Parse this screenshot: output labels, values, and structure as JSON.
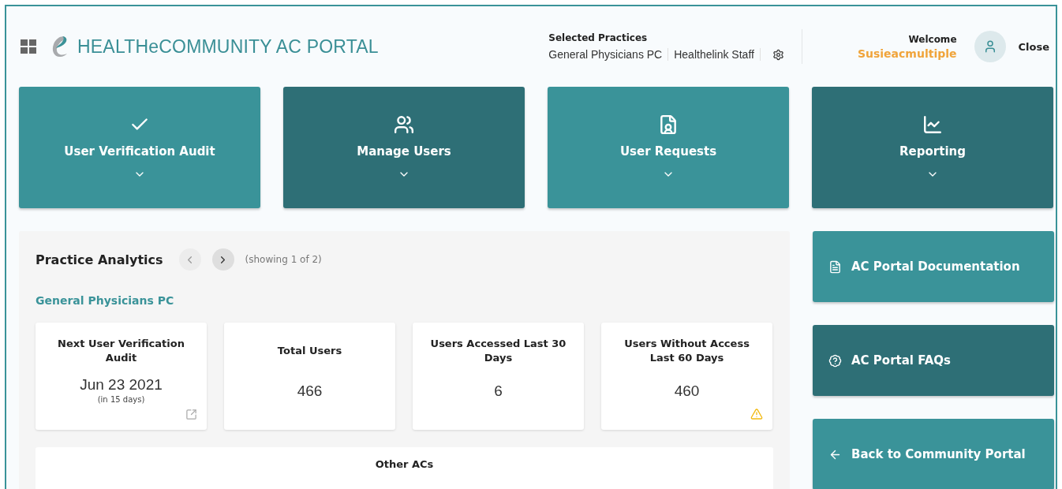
{
  "header": {
    "title": "HEALTHeCOMMUNITY AC PORTAL",
    "practices_label": "Selected Practices",
    "practices": [
      "General Physicians PC",
      "Healthelink Staff"
    ],
    "welcome": "Welcome",
    "user": "Susieacmultiple",
    "close": "Close"
  },
  "tiles": [
    {
      "label": "User Verification Audit",
      "kind": "check",
      "color": "#3a9399"
    },
    {
      "label": "Manage Users",
      "kind": "users",
      "color": "#2e6f76"
    },
    {
      "label": "User Requests",
      "kind": "request",
      "color": "#3a9399"
    },
    {
      "label": "Reporting",
      "kind": "report",
      "color": "#2e6f76"
    }
  ],
  "analytics": {
    "title": "Practice Analytics",
    "prev_disabled": true,
    "next_disabled": false,
    "showing": "(showing 1 of 2)",
    "practice": "General Physicians PC",
    "stats": [
      {
        "kind": "link",
        "label": "Next User Verification Audit",
        "value": "Jun 23 2021",
        "note": "(in 15 days)"
      },
      {
        "kind": "plain",
        "label": "Total Users",
        "value": "466"
      },
      {
        "kind": "plain",
        "label": "Users Accessed Last 30 Days",
        "value": "6"
      },
      {
        "kind": "warning",
        "label": "Users Without Access Last 60 Days",
        "value": "460"
      }
    ],
    "other_title": "Other ACs"
  },
  "links": [
    {
      "label": "AC Portal Documentation",
      "kind": "documentation",
      "color": "#3a9399"
    },
    {
      "label": "AC Portal FAQs",
      "kind": "faq",
      "color": "#2e6f76"
    },
    {
      "label": "Back to Community Portal",
      "kind": "back",
      "color": "#3a9399"
    }
  ]
}
